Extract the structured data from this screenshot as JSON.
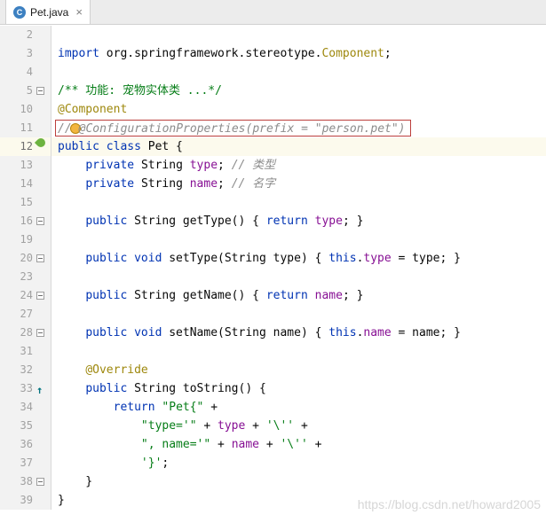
{
  "tab": {
    "title": "Pet.java",
    "close_glyph": "×",
    "icon_letter": "C"
  },
  "watermark": "https://blog.csdn.net/howard2005",
  "icons": {
    "override": "↑",
    "fold": "minus-box",
    "bean": "spring-bean-leaf",
    "bulb": "intention-lightbulb"
  },
  "colors": {
    "kw": "#0033B3",
    "pl": "#080808",
    "str": "#067D17",
    "cm": "#8C8C8C",
    "doc": "#067D17",
    "ann": "#9E880D",
    "fld": "#871094",
    "numcol": "#A1A1A1",
    "caretbg": "#FCFAED",
    "gutterbg": "#F2F2F2",
    "border": "#D1D1D1",
    "border2": "#D9D9D9",
    "redbox": "#BC3F3C",
    "bean": "#6DB33F",
    "bulb": "#F2B63F",
    "bulbBorder": "#B8860B",
    "override": "#00737F",
    "tabbarbg": "#ECECEC",
    "tabbg": "#FFFFFF",
    "classicon": "#3C80C1",
    "closecol": "#7F7F7F",
    "watermark": "#D6D6D6"
  },
  "editor": {
    "lines": [
      {
        "n": "2",
        "tokens": []
      },
      {
        "n": "3",
        "tokens": [
          {
            "s": "import ",
            "c": "kw"
          },
          {
            "s": "org.springframework.stereotype.",
            "c": "pl"
          },
          {
            "s": "Component",
            "c": "ann"
          },
          {
            "s": ";",
            "c": "pl"
          }
        ]
      },
      {
        "n": "4",
        "tokens": []
      },
      {
        "n": "5",
        "gutter": "fold",
        "tokens": [
          {
            "s": "/** 功能: 宠物实体类 ...*/",
            "c": "doc"
          }
        ]
      },
      {
        "n": "10",
        "tokens": [
          {
            "s": "@Component",
            "c": "ann"
          }
        ]
      },
      {
        "n": "11",
        "redbox": true,
        "tokens": [
          {
            "s": "//",
            "c": "cm"
          },
          {
            "icon": "bulb"
          },
          {
            "s": "@ConfigurationProperties(prefix = \"person.pet\")",
            "c": "cm"
          }
        ]
      },
      {
        "n": "12",
        "caret": true,
        "gutter": "bean",
        "tokens": [
          {
            "s": "public class ",
            "c": "kw"
          },
          {
            "s": "Pet {",
            "c": "pl"
          }
        ]
      },
      {
        "n": "13",
        "tokens": [
          {
            "s": "    ",
            "c": "pl"
          },
          {
            "s": "private ",
            "c": "kw"
          },
          {
            "s": "String ",
            "c": "pl"
          },
          {
            "s": "type",
            "c": "fld"
          },
          {
            "s": "; ",
            "c": "pl"
          },
          {
            "s": "// 类型",
            "c": "cm"
          }
        ]
      },
      {
        "n": "14",
        "tokens": [
          {
            "s": "    ",
            "c": "pl"
          },
          {
            "s": "private ",
            "c": "kw"
          },
          {
            "s": "String ",
            "c": "pl"
          },
          {
            "s": "name",
            "c": "fld"
          },
          {
            "s": "; ",
            "c": "pl"
          },
          {
            "s": "// 名字",
            "c": "cm"
          }
        ]
      },
      {
        "n": "15",
        "tokens": []
      },
      {
        "n": "16",
        "gutter": "fold",
        "tokens": [
          {
            "s": "    ",
            "c": "pl"
          },
          {
            "s": "public ",
            "c": "kw"
          },
          {
            "s": "String getType() { ",
            "c": "pl"
          },
          {
            "s": "return ",
            "c": "kw"
          },
          {
            "s": "type",
            "c": "fld"
          },
          {
            "s": "; }",
            "c": "pl"
          }
        ]
      },
      {
        "n": "19",
        "tokens": []
      },
      {
        "n": "20",
        "gutter": "fold",
        "tokens": [
          {
            "s": "    ",
            "c": "pl"
          },
          {
            "s": "public void ",
            "c": "kw"
          },
          {
            "s": "setType(String type) { ",
            "c": "pl"
          },
          {
            "s": "this",
            "c": "kw"
          },
          {
            "s": ".",
            "c": "pl"
          },
          {
            "s": "type",
            "c": "fld"
          },
          {
            "s": " = type; }",
            "c": "pl"
          }
        ]
      },
      {
        "n": "23",
        "tokens": []
      },
      {
        "n": "24",
        "gutter": "fold",
        "tokens": [
          {
            "s": "    ",
            "c": "pl"
          },
          {
            "s": "public ",
            "c": "kw"
          },
          {
            "s": "String getName() { ",
            "c": "pl"
          },
          {
            "s": "return ",
            "c": "kw"
          },
          {
            "s": "name",
            "c": "fld"
          },
          {
            "s": "; }",
            "c": "pl"
          }
        ]
      },
      {
        "n": "27",
        "tokens": []
      },
      {
        "n": "28",
        "gutter": "fold",
        "tokens": [
          {
            "s": "    ",
            "c": "pl"
          },
          {
            "s": "public void ",
            "c": "kw"
          },
          {
            "s": "setName(String name) { ",
            "c": "pl"
          },
          {
            "s": "this",
            "c": "kw"
          },
          {
            "s": ".",
            "c": "pl"
          },
          {
            "s": "name",
            "c": "fld"
          },
          {
            "s": " = name; }",
            "c": "pl"
          }
        ]
      },
      {
        "n": "31",
        "tokens": []
      },
      {
        "n": "32",
        "tokens": [
          {
            "s": "    ",
            "c": "pl"
          },
          {
            "s": "@Override",
            "c": "ann"
          }
        ]
      },
      {
        "n": "33",
        "gutter": "override",
        "tokens": [
          {
            "s": "    ",
            "c": "pl"
          },
          {
            "s": "public ",
            "c": "kw"
          },
          {
            "s": "String toString() {",
            "c": "pl"
          }
        ]
      },
      {
        "n": "34",
        "tokens": [
          {
            "s": "        ",
            "c": "pl"
          },
          {
            "s": "return ",
            "c": "kw"
          },
          {
            "s": "\"Pet{\"",
            "c": "str"
          },
          {
            "s": " +",
            "c": "pl"
          }
        ]
      },
      {
        "n": "35",
        "tokens": [
          {
            "s": "            ",
            "c": "pl"
          },
          {
            "s": "\"type='\"",
            "c": "str"
          },
          {
            "s": " + ",
            "c": "pl"
          },
          {
            "s": "type",
            "c": "fld"
          },
          {
            "s": " + ",
            "c": "pl"
          },
          {
            "s": "'\\''",
            "c": "str"
          },
          {
            "s": " +",
            "c": "pl"
          }
        ]
      },
      {
        "n": "36",
        "tokens": [
          {
            "s": "            ",
            "c": "pl"
          },
          {
            "s": "\", name='\"",
            "c": "str"
          },
          {
            "s": " + ",
            "c": "pl"
          },
          {
            "s": "name",
            "c": "fld"
          },
          {
            "s": " + ",
            "c": "pl"
          },
          {
            "s": "'\\''",
            "c": "str"
          },
          {
            "s": " +",
            "c": "pl"
          }
        ]
      },
      {
        "n": "37",
        "tokens": [
          {
            "s": "            ",
            "c": "pl"
          },
          {
            "s": "'}'",
            "c": "str"
          },
          {
            "s": ";",
            "c": "pl"
          }
        ]
      },
      {
        "n": "38",
        "gutter": "fold",
        "tokens": [
          {
            "s": "    }",
            "c": "pl"
          }
        ]
      },
      {
        "n": "39",
        "tokens": [
          {
            "s": "}",
            "c": "pl"
          }
        ]
      }
    ]
  }
}
